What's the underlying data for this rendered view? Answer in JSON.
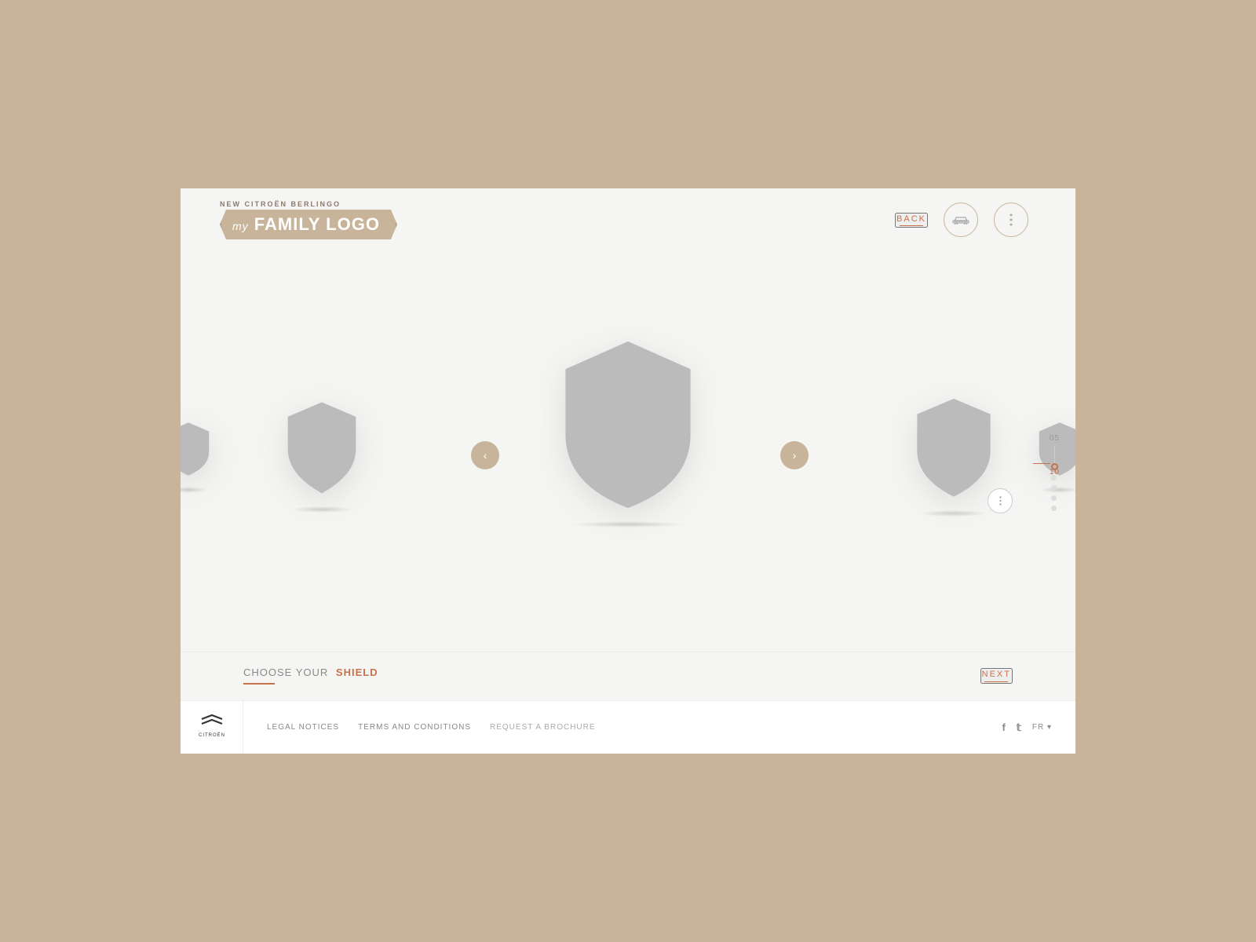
{
  "page": {
    "bg_color": "#c8b49a",
    "card_bg": "#f5f5f3"
  },
  "header": {
    "logo_subtitle": "NEW CITROËN BERLINGO",
    "logo_text_prefix": "My",
    "logo_text_main": "FAMILY LOGO",
    "back_label": "BACK",
    "car_icon": "🚗",
    "dots_icon": "⋮"
  },
  "carousel": {
    "nav_left": "‹",
    "nav_right": "›",
    "options_icon": "⋮",
    "indicator_top": "05",
    "indicator_bottom": "10",
    "dots": [
      {
        "active": true
      },
      {
        "active": false
      },
      {
        "active": false
      },
      {
        "active": false
      },
      {
        "active": false
      }
    ]
  },
  "bottom": {
    "choose_label": "CHOOSE YOUR",
    "choose_highlight": "SHIELD",
    "next_label": "NEXT"
  },
  "footer": {
    "legal_notices": "LEGAL NOTICES",
    "terms_conditions": "TERMS AND CONDITIONS",
    "request_brochure": "REQUEST A BROCHURE",
    "lang": "FR ▾",
    "facebook_icon": "f",
    "twitter_icon": "t"
  }
}
